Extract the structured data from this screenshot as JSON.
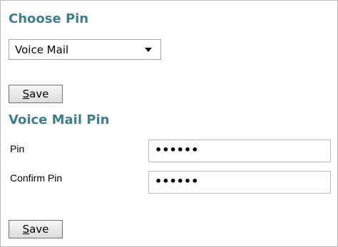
{
  "choose_pin": {
    "title": "Choose Pin",
    "select_value": "Voice Mail",
    "save_label_first": "S",
    "save_label_rest": "ave"
  },
  "voice_mail_pin": {
    "title": "Voice Mail Pin",
    "pin_label": "Pin",
    "pin_value": "••••••",
    "confirm_label": "Confirm Pin",
    "confirm_value": "••••••",
    "save_label_first": "S",
    "save_label_rest": "ave"
  }
}
